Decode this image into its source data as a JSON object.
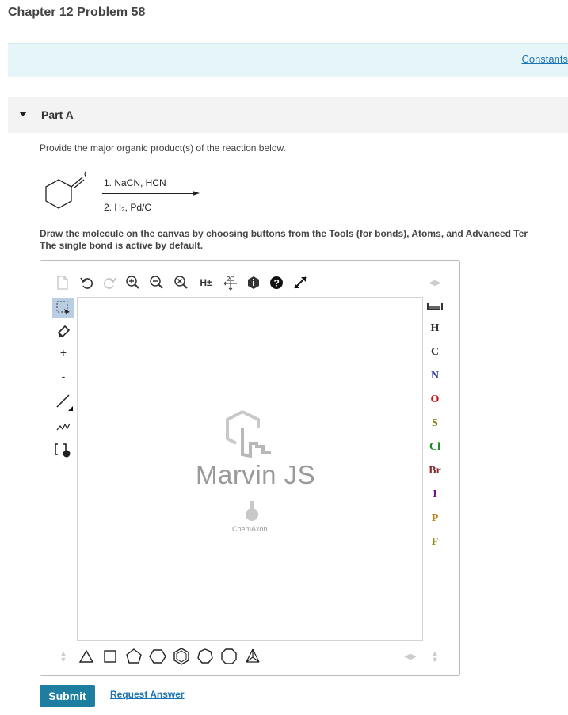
{
  "header": {
    "title": "Chapter 12 Problem 58"
  },
  "constants": {
    "link": "Constants"
  },
  "part": {
    "label": "Part A"
  },
  "problem": {
    "prompt": "Provide the major organic product(s) of the reaction below.",
    "reactant_atom_label": "O",
    "step1": "1. NaCN, HCN",
    "step2": "2. H₂, Pd/C",
    "instructions_line1": "Draw the molecule on the canvas by choosing buttons from the Tools (for bonds), Atoms, and Advanced Ter",
    "instructions_line2": "The single bond is active by default."
  },
  "toolbar": {
    "hydrogen_toggle": "H±",
    "clean2d": "2D"
  },
  "left_tools": {
    "plus": "+",
    "minus": "-"
  },
  "atoms": [
    "H",
    "C",
    "N",
    "O",
    "S",
    "Cl",
    "Br",
    "I",
    "P",
    "F"
  ],
  "atom_colors": {
    "H": "#333333",
    "C": "#333333",
    "N": "#3a44a8",
    "O": "#d01010",
    "S": "#8a7a10",
    "Cl": "#1a8a1a",
    "Br": "#8a2a2a",
    "I": "#6a1a8a",
    "P": "#c07a10",
    "F": "#8a8a10"
  },
  "watermark": {
    "title": "Marvin JS",
    "vendor": "ChemAxon"
  },
  "actions": {
    "submit": "Submit",
    "request_answer": "Request Answer"
  }
}
